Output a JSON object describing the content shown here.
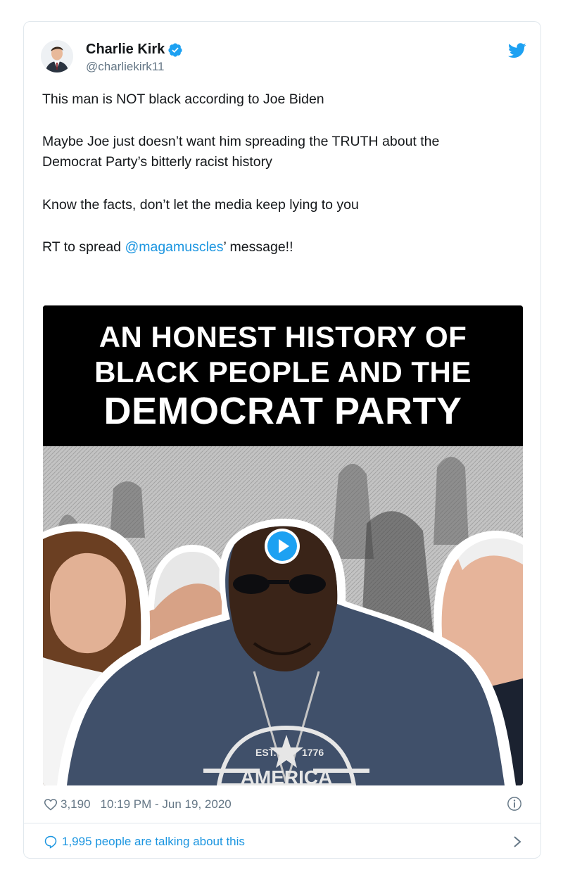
{
  "tweet": {
    "author": {
      "display_name": "Charlie Kirk",
      "handle": "@charliekirk11",
      "verified": true,
      "avatar_icon": "user-avatar"
    },
    "paragraphs": {
      "p1": "This man is NOT black according to Joe Biden",
      "p2_line1": "Maybe Joe just doesn’t want him spreading the TRUTH about the",
      "p2_line2": "Democrat Party’s bitterly racist history",
      "p3": "Know the facts, don’t let the media keep lying to you",
      "p4_prefix": "RT to spread ",
      "p4_mention": "@magamuscles",
      "p4_suffix": "’ message!!"
    },
    "media": {
      "headline_line1": "AN HONEST HISTORY OF",
      "headline_line2": "BLACK PEOPLE AND THE",
      "headline_line3": "DEMOCRAT PARTY",
      "shirt_text_left": "EST.",
      "shirt_text_right": "1776",
      "shirt_text_bottom": "AMERICA",
      "play_icon": "play-icon"
    },
    "likes": "3,190",
    "timestamp": "10:19 PM - Jun 19, 2020",
    "talking": "1,995 people are talking about this"
  },
  "colors": {
    "link": "#1b95e0",
    "text": "#14171a",
    "muted": "#657786",
    "border": "#e1e8ed"
  }
}
